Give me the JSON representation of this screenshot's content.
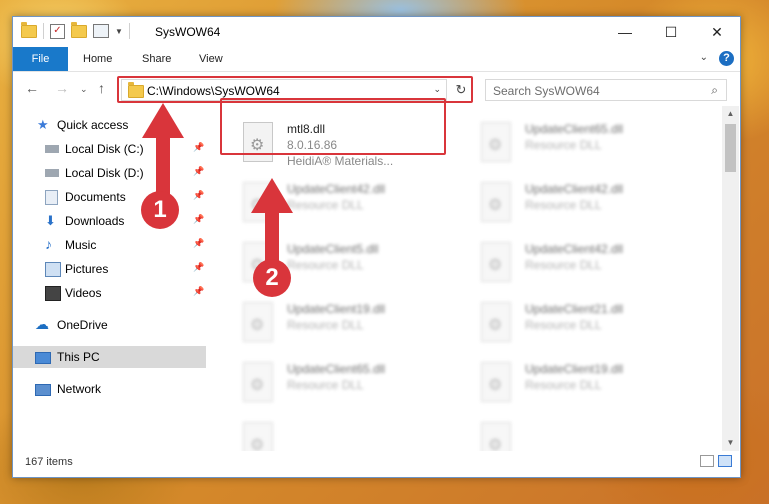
{
  "window": {
    "title": "SysWOW64",
    "controls": {
      "minimize": "—",
      "maximize": "☐",
      "close": "✕"
    }
  },
  "ribbon": {
    "tabs": [
      "File",
      "Home",
      "Share",
      "View"
    ],
    "help": "?"
  },
  "navbar": {
    "address": "C:\\Windows\\SysWOW64",
    "search_placeholder": "Search SysWOW64"
  },
  "sidebar": {
    "items": [
      {
        "label": "Quick access",
        "icon": "star-icon",
        "color": "#3b7bd8"
      },
      {
        "label": "Local Disk (C:)",
        "icon": "drive-icon",
        "pinned": true
      },
      {
        "label": "Local Disk (D:)",
        "icon": "drive-icon",
        "pinned": true
      },
      {
        "label": "Documents",
        "icon": "documents-icon",
        "pinned": true
      },
      {
        "label": "Downloads",
        "icon": "downloads-icon",
        "pinned": true
      },
      {
        "label": "Music",
        "icon": "music-icon",
        "pinned": true
      },
      {
        "label": "Pictures",
        "icon": "pictures-icon",
        "pinned": true
      },
      {
        "label": "Videos",
        "icon": "videos-icon",
        "pinned": true
      },
      {
        "label": "OneDrive",
        "icon": "onedrive-icon"
      },
      {
        "label": "This PC",
        "icon": "this-pc-icon",
        "selected": true
      },
      {
        "label": "Network",
        "icon": "network-icon"
      }
    ]
  },
  "files": {
    "selected": {
      "name": "mtl8.dll",
      "version": "8.0.16.86",
      "company": "HeidiA® Materials..."
    },
    "others": [
      {
        "name": "UpdateClient65.dll",
        "desc": "Resource DLL"
      },
      {
        "name": "UpdateClient42.dll",
        "desc": "Resource DLL"
      },
      {
        "name": "UpdateClient42.dll",
        "desc": "Resource DLL"
      },
      {
        "name": "UpdateClient5.dll",
        "desc": "Resource DLL"
      },
      {
        "name": "UpdateClient42.dll",
        "desc": "Resource DLL"
      },
      {
        "name": "UpdateClient19.dll",
        "desc": "Resource DLL"
      },
      {
        "name": "UpdateClient21.dll",
        "desc": "Resource DLL"
      },
      {
        "name": "UpdateClient65.dll",
        "desc": "Resource DLL"
      },
      {
        "name": "UpdateClient19.dll",
        "desc": "Resource DLL"
      }
    ]
  },
  "status": {
    "count": "167 items"
  },
  "callouts": [
    "1",
    "2"
  ],
  "colors": {
    "highlight": "#d9353b",
    "file_tab": "#1979ca"
  }
}
